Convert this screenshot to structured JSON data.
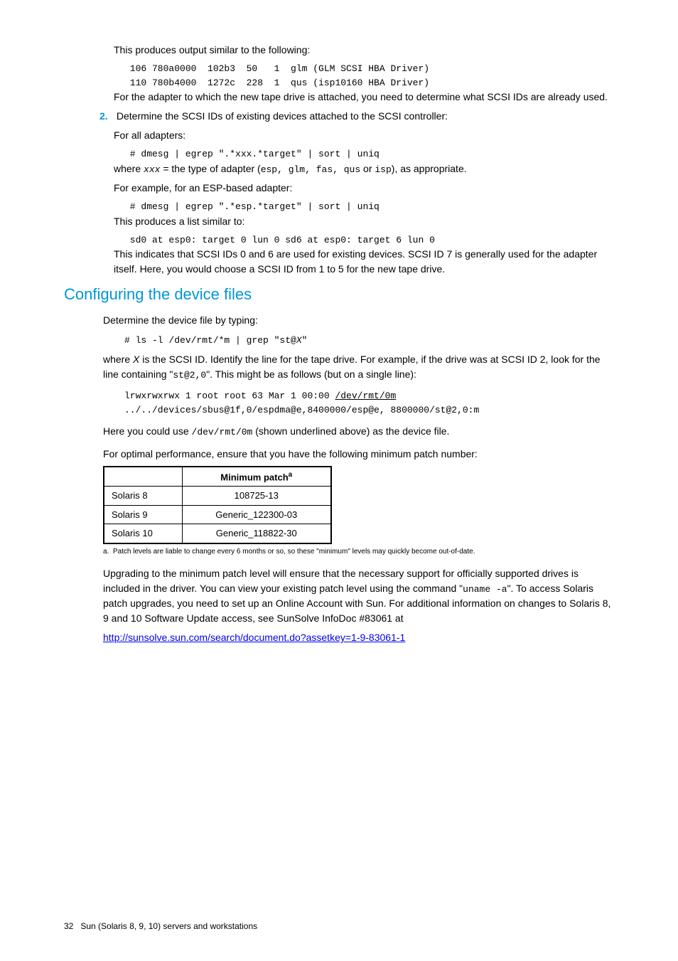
{
  "top": {
    "intro": "This produces output similar to the following:",
    "code1": " 106 780a0000  102b3  50   1  glm (GLM SCSI HBA Driver)\n 110 780b4000  1272c  228  1  qus (isp10160 HBA Driver)",
    "para1": "For the adapter to which the new tape drive is attached, you need to determine what SCSI IDs are already used."
  },
  "step2": {
    "num": "2.",
    "text": "Determine the SCSI IDs of existing devices attached to the SCSI controller:",
    "fora": "For all adapters:",
    "code1": " # dmesg | egrep \".*xxx.*target\" | sort | uniq",
    "where1": "where ",
    "where_xxx": "xxx",
    "where2": " = the type of adapter (",
    "where_list": "esp, glm, fas, qus",
    "where_or": " or ",
    "where_isp": "isp",
    "where3": "), as appropriate.",
    "forexample": "For example, for an ESP-based adapter:",
    "code2": " # dmesg | egrep \".*esp.*target\" | sort | uniq",
    "produces": "This produces a list similar to:",
    "code3": " sd0 at esp0: target 0 lun 0 sd6 at esp0: target 6 lun 0",
    "indicates": "This indicates that SCSI IDs 0 and 6 are used for existing devices. SCSI ID 7 is generally used for the adapter itself. Here, you would choose a SCSI ID from 1 to 5 for the new tape drive."
  },
  "heading": "Configuring the device files",
  "config": {
    "determine": "Determine the device file by typing:",
    "code1": "# ls -l /dev/rmt/*m | grep \"st@",
    "code1_x": "X",
    "code1_end": "\"",
    "wherex1": "where ",
    "wherex_x": "X",
    "wherex2": " is the SCSI ID. Identify the line for the tape drive. For example, if the drive was at SCSI ID 2, look for the line containing \"",
    "wherex_code": "st@2,0",
    "wherex3": "\". This might be as follows (but on a single line):",
    "code2a": "lrwxrwxrwx 1 root root 63 Mar 1 00:00 ",
    "code2_underline": "/dev/rmt/0m",
    "code2b": "../../devices/sbus@1f,0/espdma@e,8400000/esp@e, 8800000/st@2,0:m",
    "hereyou1": "Here you could use ",
    "hereyou_code": "/dev/rmt/0m",
    "hereyou2": " (shown underlined above) as the device file.",
    "optimal": "For optimal performance, ensure that you have the following minimum patch number:"
  },
  "table": {
    "header_blank": "",
    "header_patch": "Minimum patch",
    "header_sup": "a",
    "rows": [
      {
        "os": "Solaris 8",
        "patch": "108725-13"
      },
      {
        "os": "Solaris 9",
        "patch": "Generic_122300-03"
      },
      {
        "os": "Solaris 10",
        "patch": "Generic_118822-30"
      }
    ]
  },
  "table_footnote_label": "a.",
  "table_footnote": "Patch levels are liable to change every 6 months or so, so these \"minimum\" levels may quickly become out-of-date.",
  "upgrade": {
    "p1a": "Upgrading to the minimum patch level will ensure that the necessary support for officially supported drives is included in the driver. You can view your existing patch level using the command \"",
    "p1_code": "uname -a",
    "p1b": "\". To access Solaris patch upgrades, you need to set up an Online Account with Sun. For additional information on changes to Solaris 8, 9 and 10 Software Update access, see SunSolve InfoDoc #83061 at",
    "link": "http://sunsolve.sun.com/search/document.do?assetkey=1-9-83061-1"
  },
  "footer": {
    "page": "32",
    "title": "Sun (Solaris 8, 9, 10) servers and workstations"
  }
}
